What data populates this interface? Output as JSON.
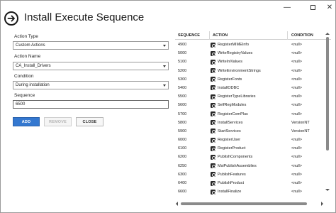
{
  "window": {
    "title": "Install Execute Sequence",
    "controls": {
      "minimize_icon": "minimize-icon",
      "maximize_icon": "maximize-icon",
      "close_icon": "close-icon",
      "minimize_glyph": "—",
      "close_glyph": "✕"
    },
    "back_icon": "arrow-right-circle-icon"
  },
  "form": {
    "action_type": {
      "label": "Action Type",
      "value": "Custom Actions"
    },
    "action_name": {
      "label": "Action Name",
      "value": "CA_Install_Drivers"
    },
    "condition": {
      "label": "Condition",
      "value": "During installation"
    },
    "sequence": {
      "label": "Sequence",
      "value": "6500"
    }
  },
  "buttons": {
    "add": "ADD",
    "remove": "REMOVE",
    "close": "CLOSE"
  },
  "grid": {
    "columns": {
      "sequence": "SEQUENCE",
      "action": "ACTION",
      "condition": "CONDITION"
    },
    "rows": [
      {
        "sequence": "4900",
        "action": "RegisterMIMEInfo",
        "condition": "<null>"
      },
      {
        "sequence": "5000",
        "action": "WriteRegistryValues",
        "condition": "<null>"
      },
      {
        "sequence": "5100",
        "action": "WriteIniValues",
        "condition": "<null>"
      },
      {
        "sequence": "5200",
        "action": "WriteEnvironmentStrings",
        "condition": "<null>"
      },
      {
        "sequence": "5300",
        "action": "RegisterFonts",
        "condition": "<null>"
      },
      {
        "sequence": "5400",
        "action": "InstallODBC",
        "condition": "<null>"
      },
      {
        "sequence": "5500",
        "action": "RegisterTypeLibraries",
        "condition": "<null>"
      },
      {
        "sequence": "5600",
        "action": "SelfRegModules",
        "condition": "<null>"
      },
      {
        "sequence": "5700",
        "action": "RegisterComPlus",
        "condition": "<null>"
      },
      {
        "sequence": "5800",
        "action": "InstallServices",
        "condition": "VersionNT"
      },
      {
        "sequence": "5900",
        "action": "StartServices",
        "condition": "VersionNT"
      },
      {
        "sequence": "6000",
        "action": "RegisterUser",
        "condition": "<null>"
      },
      {
        "sequence": "6100",
        "action": "RegisterProduct",
        "condition": "<null>"
      },
      {
        "sequence": "6200",
        "action": "PublishComponents",
        "condition": "<null>"
      },
      {
        "sequence": "6250",
        "action": "MsiPublishAssemblies",
        "condition": "<null>"
      },
      {
        "sequence": "6300",
        "action": "PublishFeatures",
        "condition": "<null>"
      },
      {
        "sequence": "6400",
        "action": "PublishProduct",
        "condition": "<null>"
      },
      {
        "sequence": "6600",
        "action": "InstallFinalize",
        "condition": "<null>"
      }
    ]
  },
  "colors": {
    "accent": "#3478d0",
    "disabled_text": "#b5b5b5"
  }
}
